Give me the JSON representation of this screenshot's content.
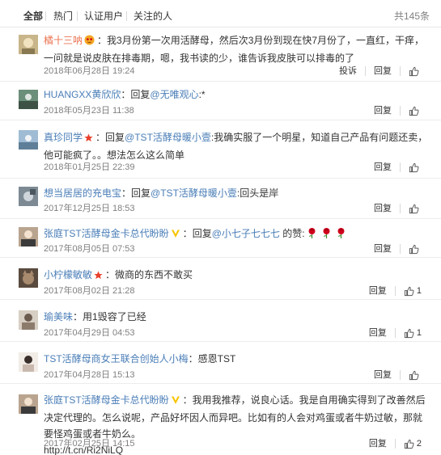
{
  "tabs": [
    "全部",
    "热门",
    "认证用户",
    "关注的人"
  ],
  "total": "共145条",
  "labels": {
    "reply": "回复",
    "report": "投诉",
    "reply_prefix": "回复"
  },
  "comments": [
    {
      "user": "橘十三呐",
      "text": "：我3月份第一次用活酵母，然后次3月份到现在快7月份了，一直红，干痒，一问就是说皮肤在排毒期，嗯，我书读的少，谁告诉我皮肤可以排毒的了",
      "time": "2018年06月28日 19:24",
      "likes": ""
    },
    {
      "user": "HUANGXX黄欣欣",
      "mention": "@无唯观心",
      "text": ":*",
      "time": "2018年05月23日 11:38",
      "likes": ""
    },
    {
      "user": "真珍同学",
      "mention": "@TST活酵母暖小壹",
      "text": ":我确实服了一个明星，知道自己产品有问题还卖，他可能疯了。。想法怎么这么简单",
      "time": "2018年01月25日 22:39",
      "likes": ""
    },
    {
      "user": "想当居居的充电宝",
      "mention": "@TST活酵母暖小壹",
      "text": ":回头是岸",
      "time": "2017年12月25日 18:53",
      "likes": ""
    },
    {
      "user": "张庭TST活酵母金卡总代盼盼",
      "mention": "@小七子七七七",
      "text": " 的赞:",
      "time": "2017年08月05日 07:53",
      "likes": ""
    },
    {
      "user": "小柠檬敏敏",
      "text": "：微商的东西不敢买",
      "time": "2017年08月02日 21:28",
      "likes": "1"
    },
    {
      "user": "瑜美味",
      "text": "：用1毁容了已经",
      "time": "2017年04月29日 04:53",
      "likes": "1"
    },
    {
      "user": "TST活酵母商女王联合创始人小梅",
      "text": "：感恩TST",
      "time": "2017年04月28日 15:13",
      "likes": ""
    },
    {
      "user": "张庭TST活酵母金卡总代盼盼",
      "text": "：我用我推荐，说良心话。我是自用确实得到了改善然后决定代理的。怎么说呢，产品好坏因人而异吧。比如有的人会对鸡蛋或者牛奶过敏，那就要怪鸡蛋或者牛奶么。",
      "link": "http://t.cn/Ri2NiLQ",
      "time": "2017年02月25日 14:15",
      "likes": "2"
    }
  ]
}
